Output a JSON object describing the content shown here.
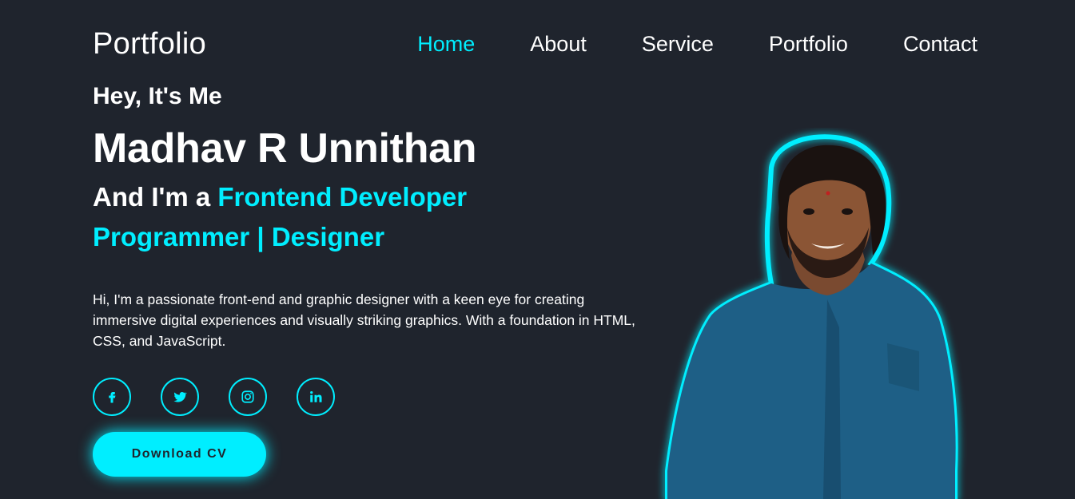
{
  "header": {
    "logo": "Portfolio",
    "nav": [
      {
        "label": "Home",
        "active": true
      },
      {
        "label": "About",
        "active": false
      },
      {
        "label": "Service",
        "active": false
      },
      {
        "label": "Portfolio",
        "active": false
      },
      {
        "label": "Contact",
        "active": false
      }
    ]
  },
  "hero": {
    "greeting": "Hey, It's Me",
    "name": "Madhav R Unnithan",
    "role_prefix": "And I'm a ",
    "role_line1": "Frontend Developer",
    "role_line2": "Programmer | Designer",
    "bio": "Hi, I'm a passionate front-end and graphic designer with a keen eye for creating immersive digital experiences and visually striking graphics. With a foundation in HTML, CSS, and JavaScript.",
    "social": [
      {
        "icon": "facebook-icon"
      },
      {
        "icon": "twitter-icon"
      },
      {
        "icon": "instagram-icon"
      },
      {
        "icon": "linkedin-icon"
      }
    ],
    "cta_label": "Download CV"
  },
  "colors": {
    "background": "#1f242d",
    "accent": "#00eeff",
    "text": "#ffffff"
  }
}
